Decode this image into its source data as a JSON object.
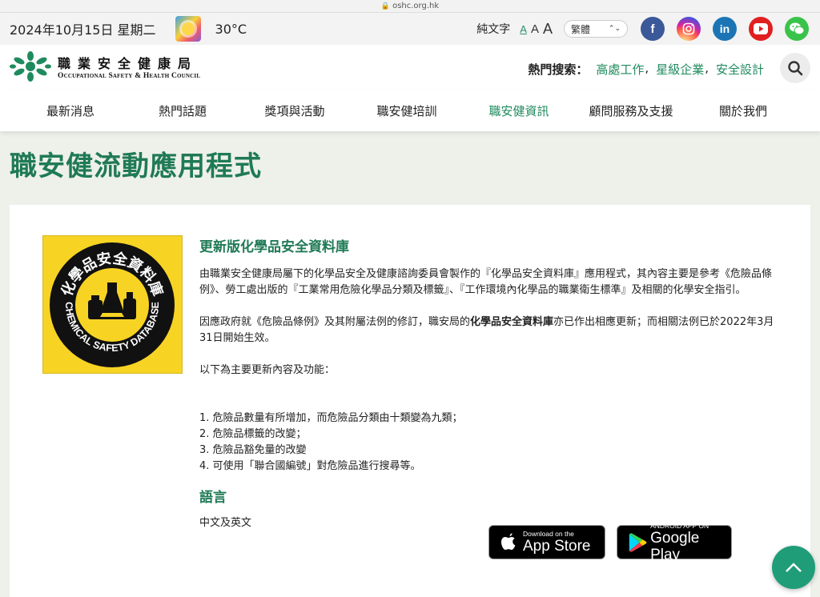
{
  "browser": {
    "url": "oshc.org.hk"
  },
  "topbar": {
    "date": "2024年10月15日 星期二",
    "temperature": "30°C",
    "weather_icon": "sunny-weather-icon",
    "pure_text": "純文字",
    "font_sizes": [
      "A",
      "A",
      "A"
    ],
    "language": "繁體",
    "social": [
      {
        "name": "facebook-icon",
        "glyph": "f"
      },
      {
        "name": "instagram-icon",
        "glyph": "◎"
      },
      {
        "name": "linkedin-icon",
        "glyph": "in"
      },
      {
        "name": "youtube-icon",
        "glyph": "▶"
      },
      {
        "name": "wechat-icon",
        "glyph": "●"
      }
    ]
  },
  "header": {
    "logo_cn": "職業安全健康局",
    "logo_en": "Occupational Safety & Health Council",
    "hot_label": "熱門搜索：",
    "hot_keywords": [
      "高處工作",
      "星級企業",
      "安全設計"
    ],
    "hot_separator": ",",
    "search_icon": "search-icon"
  },
  "nav": {
    "items": [
      "最新消息",
      "熱門話題",
      "獎項與活動",
      "職安健培訓",
      "職安健資訊",
      "顧問服務及支援",
      "關於我們"
    ],
    "active_index": 4
  },
  "page": {
    "title": "職安健流動應用程式"
  },
  "app": {
    "icon_text_top": "化學品安全資料庫",
    "icon_text_bottom": "CHEMICAL SAFETY DATABASE",
    "heading": "更新版化學品安全資料庫",
    "para1": "由職業安全健康局屬下的化學品安全及健康諮詢委員會製作的『化學品安全資料庫』應用程式，其內容主要是參考《危險品條例》、勞工處出版的『工業常用危險化學品分類及標籤』、『工作環境內化學品的職業衛生標準』及相關的化學安全指引。",
    "para2_pre": "因應政府就《危險品條例》及其附屬法例的修訂，職安局的",
    "para2_bold": "化學品安全資料庫",
    "para2_post": "亦已作出相應更新；而相關法例已於2022年3月31日開始生效。",
    "para3": "以下為主要更新內容及功能：",
    "list": [
      "1. 危險品數量有所增加，而危險品分類由十類變為九類；",
      "2. 危險品標籤的改變；",
      "3. 危險品豁免量的改變",
      "4. 可使用「聯合國編號」對危險品進行搜尋等。"
    ],
    "lang_heading": "語言",
    "lang_value": "中文及英文",
    "appstore_small": "Download on the",
    "appstore_big": "App Store",
    "gplay_small": "ANDROID APP ON",
    "gplay_big": "Google Play"
  },
  "back_to_top": {
    "icon": "chevron-up-icon",
    "glyph": "∧"
  }
}
